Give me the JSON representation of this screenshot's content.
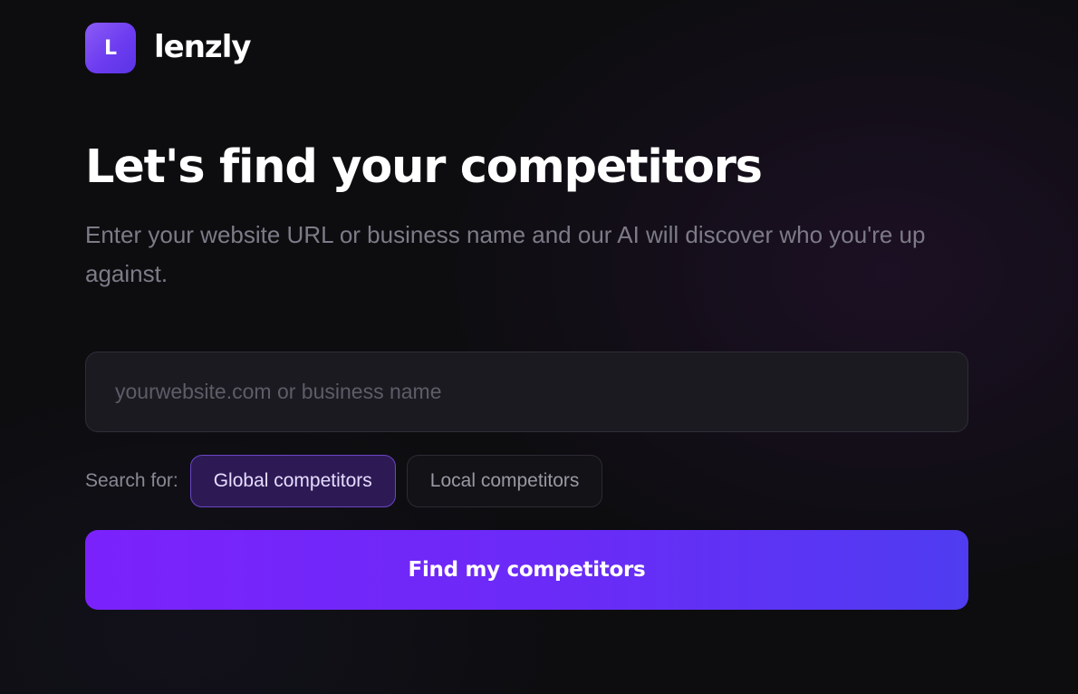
{
  "brand": {
    "mark_letter": "L",
    "name": "lenzly",
    "accent": "#7c3aed"
  },
  "hero": {
    "title": "Let's find your competitors",
    "subtitle": "Enter your website URL or business name and our AI will discover who you're up against."
  },
  "search": {
    "placeholder": "yourwebsite.com or business name",
    "value": ""
  },
  "scope": {
    "label": "Search for:",
    "options": [
      {
        "label": "Global competitors",
        "selected": true
      },
      {
        "label": "Local competitors",
        "selected": false
      }
    ]
  },
  "cta": {
    "label": "Find my competitors",
    "gradient": [
      "#7b22fb",
      "#4f3cf1"
    ]
  }
}
